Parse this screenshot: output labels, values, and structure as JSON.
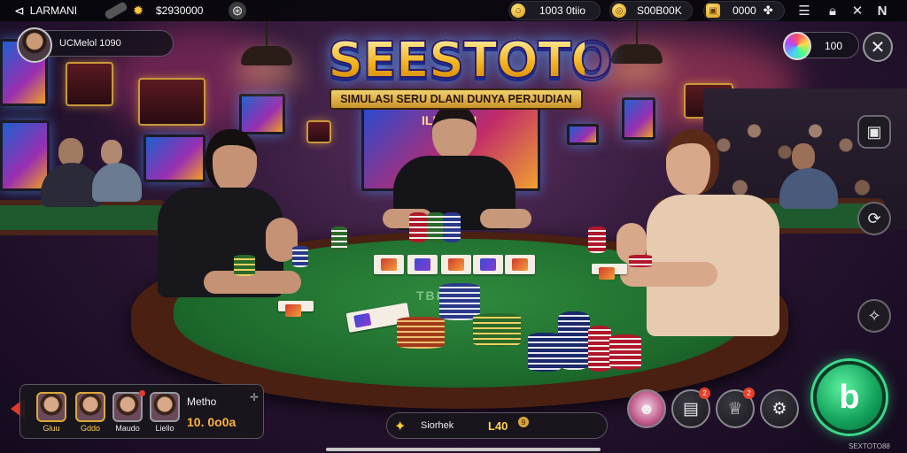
{
  "topbar": {
    "username": "LARMANI",
    "balance": "$2930000",
    "coins_1": "1003 0tiio",
    "coins_2": "S00B00K",
    "coins_3": "0000",
    "icons": [
      "pen-icon",
      "gear-icon",
      "settings-icon",
      "coin-icon",
      "gold-coin-icon",
      "treasure-icon",
      "menu-icon",
      "lock-icon",
      "close-icon",
      "network-icon"
    ]
  },
  "profile": {
    "name": "UCMelol 1090"
  },
  "logo": {
    "title": "SEESTOTO",
    "subtitle": "SIMULASI SERU DLANI DUNYA PERJUDIAN"
  },
  "right_panel": {
    "value": "100",
    "close_symbol": "✕"
  },
  "felt_text": "TBRE",
  "scene_sign_text": "ILLU TTN",
  "side_buttons": [
    "gallery-button",
    "refresh-button",
    "share-button"
  ],
  "players": {
    "label": "Metho",
    "amount": "10. 0o0a",
    "names": [
      "Gluu",
      "Gddo",
      "Maudo",
      "Liello"
    ]
  },
  "center_bar": {
    "label": "Siorhek",
    "value": "L40",
    "badge": "9"
  },
  "actions": {
    "badge_2": "2",
    "badge_3": "2"
  },
  "watermark": "SEXTOTO88"
}
